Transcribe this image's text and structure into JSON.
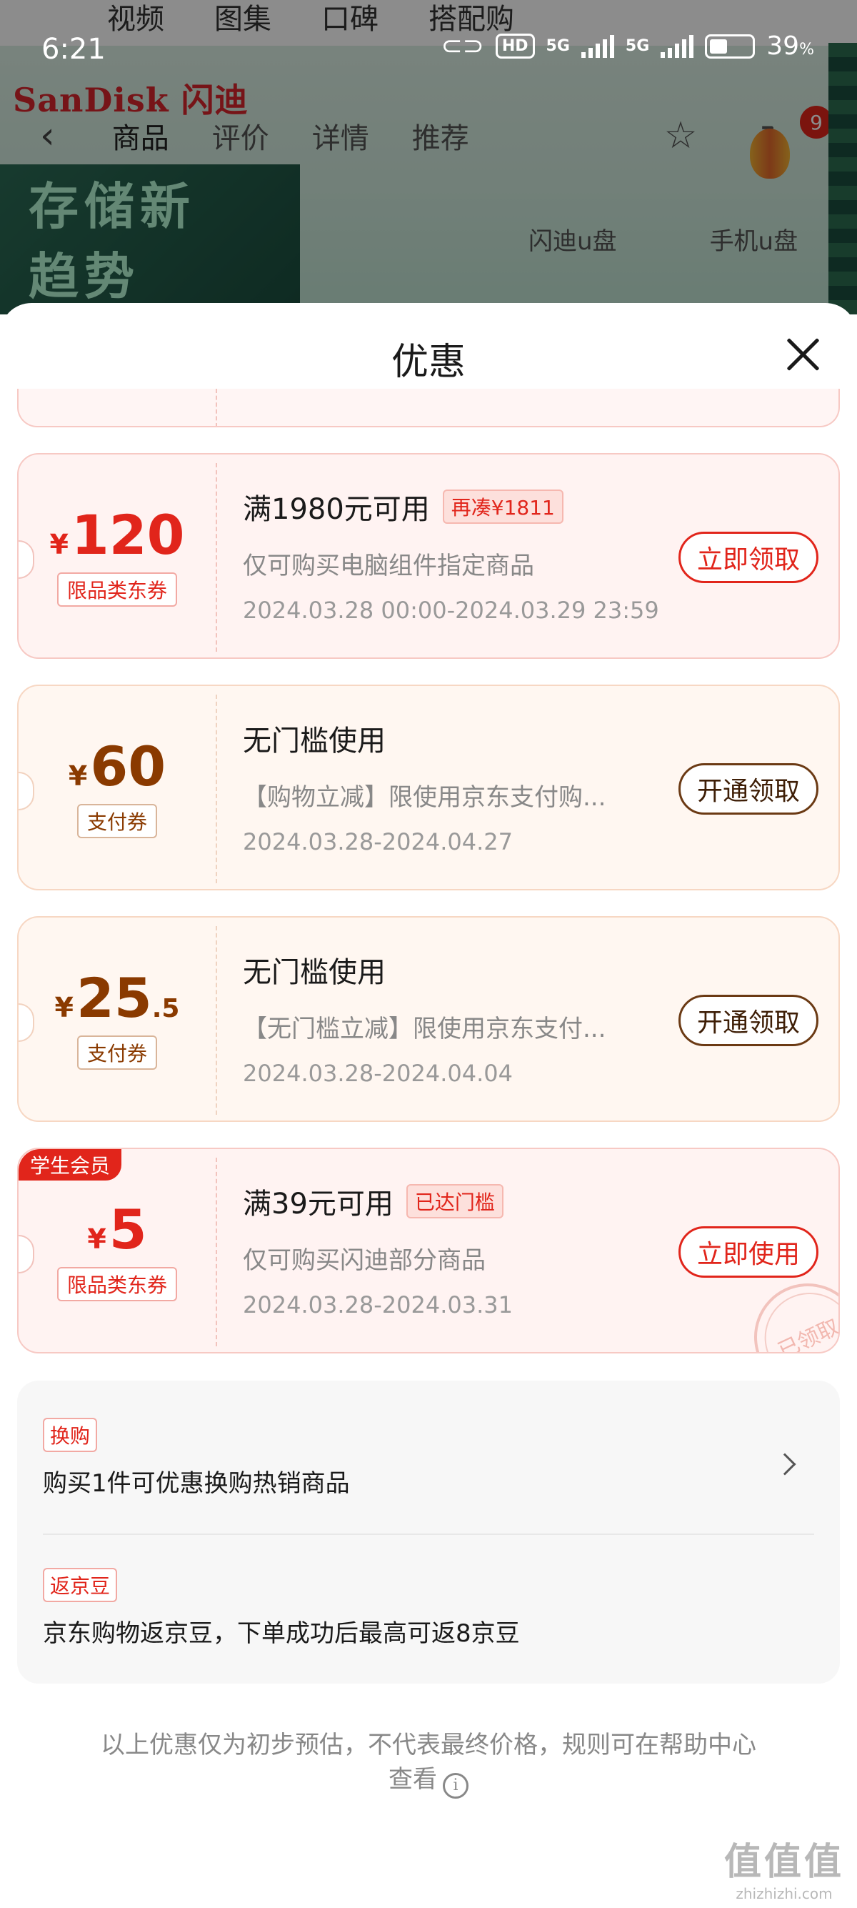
{
  "status_bar": {
    "time": "6:21",
    "hd_label": "HD",
    "sim1_label": "5G",
    "sim2_label": "5G",
    "battery_value": "39",
    "battery_unit": "%",
    "battery_level": 0.39
  },
  "background": {
    "top_tabs": [
      "视频",
      "图集",
      "口碑",
      "搭配购"
    ],
    "brand": "SanDisk 闪迪",
    "nav_tabs": [
      "商品",
      "评价",
      "详情",
      "推荐"
    ],
    "cart_badge": "9",
    "promo_text": "存储新趋势",
    "categories": [
      "闪迪u盘",
      "手机u盘"
    ]
  },
  "sheet": {
    "title": "优惠"
  },
  "coupons": [
    {
      "currency": "¥",
      "amount": "120",
      "amount_decimal": "",
      "type_tag": "限品类东券",
      "title": "满1980元可用",
      "badge": "再凑¥1811",
      "desc": "仅可购买电脑组件指定商品",
      "date": "2024.03.28 00:00-2024.03.29 23:59",
      "button": "立即领取"
    },
    {
      "currency": "¥",
      "amount": "60",
      "amount_decimal": "",
      "type_tag": "支付券",
      "title": "无门槛使用",
      "badge": "",
      "desc": "【购物立减】限使用京东支付购...",
      "date": "2024.03.28-2024.04.27",
      "button": "开通领取"
    },
    {
      "currency": "¥",
      "amount": "25",
      "amount_decimal": ".5",
      "type_tag": "支付券",
      "title": "无门槛使用",
      "badge": "",
      "desc": "【无门槛立减】限使用京东支付...",
      "date": "2024.03.28-2024.04.04",
      "button": "开通领取"
    },
    {
      "currency": "¥",
      "amount": "5",
      "amount_decimal": "",
      "type_tag": "限品类东券",
      "member_tag": "学生会员",
      "title": "满39元可用",
      "badge": "已达门槛",
      "desc": "仅可购买闪迪部分商品",
      "date": "2024.03.28-2024.03.31",
      "button": "立即使用",
      "stamp": "已领取"
    }
  ],
  "offers": [
    {
      "tag": "换购",
      "text": "购买1件可优惠换购热销商品"
    },
    {
      "tag": "返京豆",
      "text": "京东购物返京豆，下单成功后最高可返8京豆"
    }
  ],
  "disclaimer": "以上优惠仅为初步预估，不代表最终价格，规则可在帮助中心查看",
  "watermark": {
    "logo": "值值值",
    "url": "zhizhizhi.com"
  },
  "colors": {
    "accent_red": "#e1251b",
    "pay_brown": "#8a3a00",
    "coupon_bg": "#fff3f2"
  }
}
